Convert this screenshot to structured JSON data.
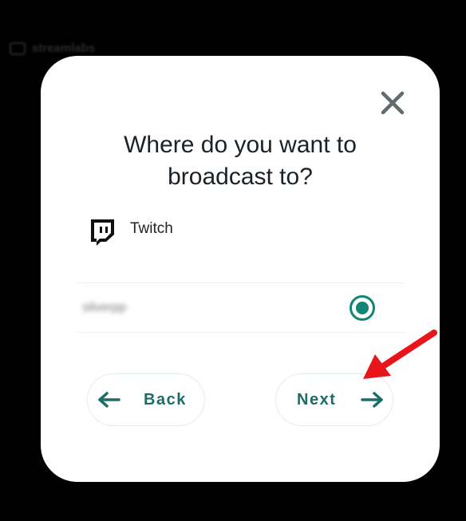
{
  "background": {
    "logo_text": "streamlabs"
  },
  "dialog": {
    "title": "Where do you want to\nbroadcast to?",
    "platform": {
      "name": "Twitch",
      "icon": "twitch-icon"
    },
    "account": {
      "name": "silverpp",
      "selected": true
    },
    "back_label": "Back",
    "next_label": "Next"
  },
  "colors": {
    "accent": "#128675",
    "button_text": "#1b6d67",
    "annotation_arrow": "#e8161b"
  }
}
